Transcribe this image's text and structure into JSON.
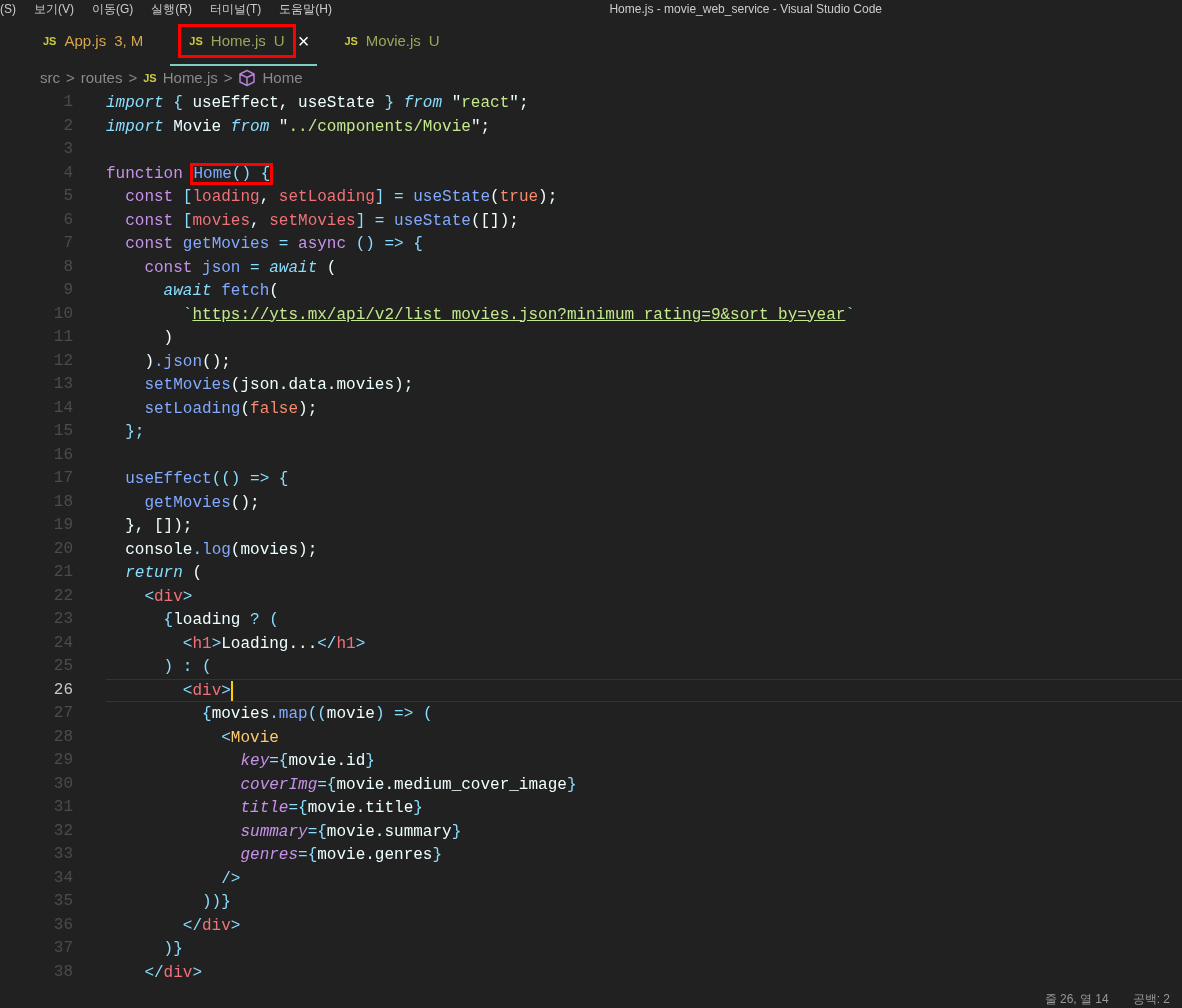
{
  "menu_bar": {
    "items": [
      "(S)",
      "보기(V)",
      "이동(G)",
      "실행(R)",
      "터미널(T)",
      "도움말(H)"
    ],
    "title": "Home.js - movie_web_service - Visual Studio Code"
  },
  "tabs": [
    {
      "icon": "JS",
      "label": "App.js",
      "badge": "3, M",
      "selected": false,
      "annotated": false
    },
    {
      "icon": "JS",
      "label": "Home.js",
      "badge": "U",
      "close": "×",
      "selected": true,
      "annotated": true
    },
    {
      "icon": "JS",
      "label": "Movie.js",
      "badge": "U",
      "selected": false,
      "annotated": false
    }
  ],
  "breadcrumb": [
    {
      "kind": "folder",
      "text": "src"
    },
    {
      "kind": "separator",
      "text": ">"
    },
    {
      "kind": "folder",
      "text": "routes"
    },
    {
      "kind": "separator",
      "text": ">"
    },
    {
      "kind": "file",
      "icon": "JS",
      "text": "Home.js"
    },
    {
      "kind": "separator",
      "text": ">"
    },
    {
      "kind": "symbol",
      "text": "Home"
    }
  ],
  "editor": {
    "lines": [
      {
        "number": "1",
        "current": false,
        "tokens": [
          {
            "text": "import",
            "kind": "ikw"
          },
          {
            "text": " {",
            "kind": "pu"
          },
          {
            "text": " useEffect, useState ",
            "kind": "p"
          },
          {
            "text": "} ",
            "kind": "pu"
          },
          {
            "text": "from",
            "kind": "ikw"
          },
          {
            "text": " \"",
            "kind": "p"
          },
          {
            "text": "react",
            "kind": "str"
          },
          {
            "text": "\";",
            "kind": "p"
          }
        ]
      },
      {
        "number": "2",
        "current": false,
        "tokens": [
          {
            "text": "import",
            "kind": "ikw"
          },
          {
            "text": " Movie ",
            "kind": "p"
          },
          {
            "text": "from",
            "kind": "ikw"
          },
          {
            "text": " \"",
            "kind": "p"
          },
          {
            "text": "../components/Movie",
            "kind": "str"
          },
          {
            "text": "\";",
            "kind": "p"
          }
        ]
      },
      {
        "number": "3",
        "current": false
      },
      {
        "number": "4",
        "current": false,
        "tokens": [
          {
            "text": "function ",
            "kind": "kw"
          },
          {
            "text": "Home",
            "kind": "fn",
            "boxed": true
          },
          {
            "text": "() {",
            "kind": "pu",
            "boxed": true
          }
        ]
      },
      {
        "number": "5",
        "current": false,
        "tokens": [
          {
            "text": "  const",
            "kind": "kw"
          },
          {
            "text": " [",
            "kind": "pu"
          },
          {
            "text": "loading",
            "kind": "var"
          },
          {
            "text": ", ",
            "kind": "p"
          },
          {
            "text": "setLoading",
            "kind": "var"
          },
          {
            "text": "] = ",
            "kind": "pu"
          },
          {
            "text": "useState",
            "kind": "fn"
          },
          {
            "text": "(",
            "kind": "p"
          },
          {
            "text": "true",
            "kind": "lit"
          },
          {
            "text": ");",
            "kind": "p"
          }
        ]
      },
      {
        "number": "6",
        "current": false,
        "tokens": [
          {
            "text": "  const",
            "kind": "kw"
          },
          {
            "text": " [",
            "kind": "pu"
          },
          {
            "text": "movies",
            "kind": "var"
          },
          {
            "text": ", ",
            "kind": "p"
          },
          {
            "text": "setMovies",
            "kind": "var"
          },
          {
            "text": "] = ",
            "kind": "pu"
          },
          {
            "text": "useState",
            "kind": "fn"
          },
          {
            "text": "([]);",
            "kind": "p"
          }
        ]
      },
      {
        "number": "7",
        "current": false,
        "tokens": [
          {
            "text": "  const",
            "kind": "kw"
          },
          {
            "text": " getMovies",
            "kind": "fn"
          },
          {
            "text": " = ",
            "kind": "pu"
          },
          {
            "text": "async",
            "kind": "kw"
          },
          {
            "text": " () => {",
            "kind": "pu"
          }
        ]
      },
      {
        "number": "8",
        "current": false,
        "tokens": [
          {
            "text": "    const",
            "kind": "kw"
          },
          {
            "text": " json",
            "kind": "fn"
          },
          {
            "text": " = ",
            "kind": "pu"
          },
          {
            "text": "await",
            "kind": "ikw"
          },
          {
            "text": " (",
            "kind": "p"
          }
        ]
      },
      {
        "number": "9",
        "current": false,
        "tokens": [
          {
            "text": "      await",
            "kind": "ikw"
          },
          {
            "text": " fetch",
            "kind": "fn"
          },
          {
            "text": "(",
            "kind": "p"
          }
        ]
      },
      {
        "number": "10",
        "current": false,
        "tokens": [
          {
            "text": "        `",
            "kind": "pu"
          },
          {
            "text": "https://yts.mx/api/v2/list_movies.json?minimum_rating=9&sort_by=year",
            "kind": "url"
          },
          {
            "text": "`",
            "kind": "pu"
          }
        ]
      },
      {
        "number": "11",
        "current": false,
        "tokens": [
          {
            "text": "      )",
            "kind": "p"
          }
        ]
      },
      {
        "number": "12",
        "current": false,
        "tokens": [
          {
            "text": "    )",
            "kind": "p"
          },
          {
            "text": ".json",
            "kind": "fn"
          },
          {
            "text": "();",
            "kind": "p"
          }
        ]
      },
      {
        "number": "13",
        "current": false,
        "tokens": [
          {
            "text": "    setMovies",
            "kind": "fn"
          },
          {
            "text": "(json.data.movies);",
            "kind": "p"
          }
        ]
      },
      {
        "number": "14",
        "current": false,
        "tokens": [
          {
            "text": "    setLoading",
            "kind": "fn"
          },
          {
            "text": "(",
            "kind": "p"
          },
          {
            "text": "false",
            "kind": "lit"
          },
          {
            "text": ");",
            "kind": "p"
          }
        ]
      },
      {
        "number": "15",
        "current": false,
        "tokens": [
          {
            "text": "  };",
            "kind": "pu"
          }
        ]
      },
      {
        "number": "16",
        "current": false
      },
      {
        "number": "17",
        "current": false,
        "tokens": [
          {
            "text": "  useEffect",
            "kind": "fn"
          },
          {
            "text": "(() => {",
            "kind": "pu"
          }
        ]
      },
      {
        "number": "18",
        "current": false,
        "tokens": [
          {
            "text": "    getMovies",
            "kind": "fn"
          },
          {
            "text": "();",
            "kind": "p"
          }
        ]
      },
      {
        "number": "19",
        "current": false,
        "tokens": [
          {
            "text": "  }, []);",
            "kind": "p"
          }
        ]
      },
      {
        "number": "20",
        "current": false,
        "tokens": [
          {
            "text": "  console",
            "kind": "p"
          },
          {
            "text": ".",
            "kind": "pu"
          },
          {
            "text": "log",
            "kind": "fn"
          },
          {
            "text": "(movies);",
            "kind": "p"
          }
        ]
      },
      {
        "number": "21",
        "current": false,
        "tokens": [
          {
            "text": "  return",
            "kind": "ikw"
          },
          {
            "text": " (",
            "kind": "p"
          }
        ]
      },
      {
        "number": "22",
        "current": false,
        "tokens": [
          {
            "text": "    <",
            "kind": "pu"
          },
          {
            "text": "div",
            "kind": "tag"
          },
          {
            "text": ">",
            "kind": "pu"
          }
        ]
      },
      {
        "number": "23",
        "current": false,
        "tokens": [
          {
            "text": "      {",
            "kind": "pu"
          },
          {
            "text": "loading",
            "kind": "p"
          },
          {
            "text": " ? (",
            "kind": "pu"
          }
        ]
      },
      {
        "number": "24",
        "current": false,
        "tokens": [
          {
            "text": "        <",
            "kind": "pu"
          },
          {
            "text": "h1",
            "kind": "tag"
          },
          {
            "text": ">",
            "kind": "pu"
          },
          {
            "text": "Loading...",
            "kind": "p"
          },
          {
            "text": "</",
            "kind": "pu"
          },
          {
            "text": "h1",
            "kind": "tag"
          },
          {
            "text": ">",
            "kind": "pu"
          }
        ]
      },
      {
        "number": "25",
        "current": false,
        "tokens": [
          {
            "text": "      ) : (",
            "kind": "pu"
          }
        ]
      },
      {
        "number": "26",
        "current": true,
        "tokens": [
          {
            "text": "        <",
            "kind": "pu"
          },
          {
            "text": "div",
            "kind": "tag"
          },
          {
            "text": ">",
            "kind": "pu"
          }
        ]
      },
      {
        "number": "27",
        "current": false,
        "tokens": [
          {
            "text": "          {",
            "kind": "pu"
          },
          {
            "text": "movies",
            "kind": "p"
          },
          {
            "text": ".",
            "kind": "pu"
          },
          {
            "text": "map",
            "kind": "fn"
          },
          {
            "text": "((",
            "kind": "pu"
          },
          {
            "text": "movie",
            "kind": "p"
          },
          {
            "text": ") => (",
            "kind": "pu"
          }
        ]
      },
      {
        "number": "28",
        "current": false,
        "tokens": [
          {
            "text": "            <",
            "kind": "pu"
          },
          {
            "text": "Movie",
            "kind": "comp"
          }
        ]
      },
      {
        "number": "29",
        "current": false,
        "tokens": [
          {
            "text": "              key",
            "kind": "attr"
          },
          {
            "text": "={",
            "kind": "pu"
          },
          {
            "text": "movie.id",
            "kind": "p"
          },
          {
            "text": "}",
            "kind": "pu"
          }
        ]
      },
      {
        "number": "30",
        "current": false,
        "tokens": [
          {
            "text": "              coverImg",
            "kind": "attr"
          },
          {
            "text": "={",
            "kind": "pu"
          },
          {
            "text": "movie.medium_cover_image",
            "kind": "p"
          },
          {
            "text": "}",
            "kind": "pu"
          }
        ]
      },
      {
        "number": "31",
        "current": false,
        "tokens": [
          {
            "text": "              title",
            "kind": "attr"
          },
          {
            "text": "={",
            "kind": "pu"
          },
          {
            "text": "movie.title",
            "kind": "p"
          },
          {
            "text": "}",
            "kind": "pu"
          }
        ]
      },
      {
        "number": "32",
        "current": false,
        "tokens": [
          {
            "text": "              summary",
            "kind": "attr"
          },
          {
            "text": "={",
            "kind": "pu"
          },
          {
            "text": "movie.summary",
            "kind": "p"
          },
          {
            "text": "}",
            "kind": "pu"
          }
        ]
      },
      {
        "number": "33",
        "current": false,
        "tokens": [
          {
            "text": "              genres",
            "kind": "attr"
          },
          {
            "text": "={",
            "kind": "pu"
          },
          {
            "text": "movie.genres",
            "kind": "p"
          },
          {
            "text": "}",
            "kind": "pu"
          }
        ]
      },
      {
        "number": "34",
        "current": false,
        "tokens": [
          {
            "text": "            />",
            "kind": "pu"
          }
        ]
      },
      {
        "number": "35",
        "current": false,
        "tokens": [
          {
            "text": "          ))}",
            "kind": "pu"
          }
        ]
      },
      {
        "number": "36",
        "current": false,
        "tokens": [
          {
            "text": "        </",
            "kind": "pu"
          },
          {
            "text": "div",
            "kind": "tag"
          },
          {
            "text": ">",
            "kind": "pu"
          }
        ]
      },
      {
        "number": "37",
        "current": false,
        "tokens": [
          {
            "text": "      )}",
            "kind": "pu"
          }
        ]
      },
      {
        "number": "38",
        "current": false,
        "tokens": [
          {
            "text": "    </",
            "kind": "pu"
          },
          {
            "text": "div",
            "kind": "tag"
          },
          {
            "text": ">",
            "kind": "pu"
          }
        ]
      }
    ]
  },
  "status_bar": {
    "position": "줄 26, 열 14",
    "indentation": "공백: 2"
  }
}
